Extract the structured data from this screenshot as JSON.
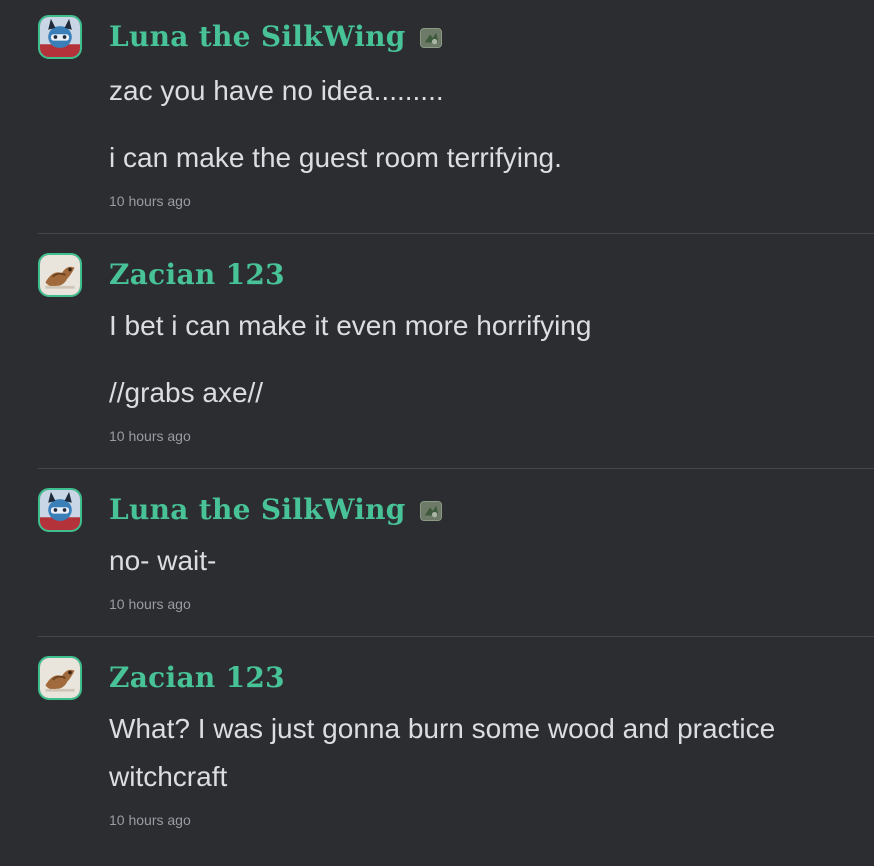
{
  "messages": [
    {
      "author": "Luna the SilkWing",
      "avatar": "luna-avatar",
      "badge": "custom-badge-icon",
      "paragraphs": [
        "zac you have no idea.........",
        "i can make the guest room terrifying."
      ],
      "time": "10 hours ago"
    },
    {
      "author": "Zacian 123",
      "avatar": "zacian-avatar",
      "badge": "",
      "paragraphs": [
        "I bet i can make it even more horrifying",
        "//grabs axe//"
      ],
      "time": "10 hours ago"
    },
    {
      "author": "Luna the SilkWing",
      "avatar": "luna-avatar",
      "badge": "custom-badge-icon",
      "paragraphs": [
        "no- wait-"
      ],
      "time": "10 hours ago"
    },
    {
      "author": "Zacian 123",
      "avatar": "zacian-avatar",
      "badge": "",
      "paragraphs": [
        "What? I was just gonna burn some wood and practice witchcraft"
      ],
      "time": "10 hours ago"
    }
  ],
  "colors": {
    "background": "#2b2d31",
    "author": "#48c297",
    "text": "#dcdde0",
    "timestamp": "#9a9ca3",
    "divider": "#44474d"
  }
}
